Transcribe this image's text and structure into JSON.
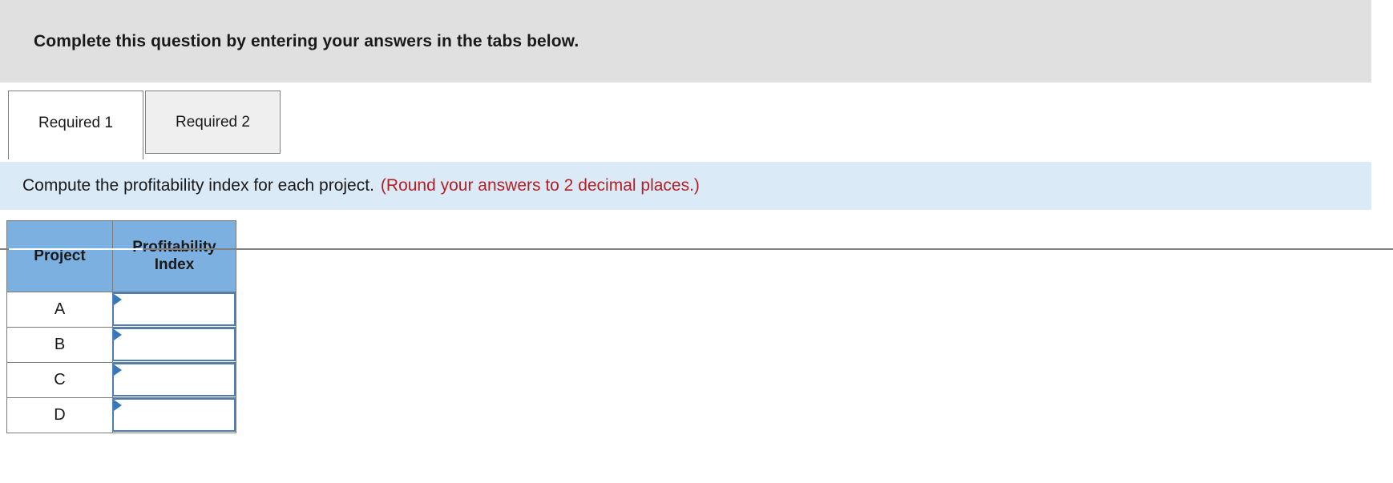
{
  "banner": {
    "text": "Complete this question by entering your answers in the tabs below."
  },
  "tabs": [
    {
      "label": "Required 1",
      "active": true,
      "name": "tab-required-1"
    },
    {
      "label": "Required 2",
      "active": false,
      "name": "tab-required-2"
    }
  ],
  "instruction": {
    "main": "Compute the profitability index for each project.",
    "note": "(Round your answers to 2 decimal places.)"
  },
  "table": {
    "headers": [
      "Project",
      "Profitability Index"
    ],
    "header_project": "Project",
    "header_index_line1": "Profitability",
    "header_index_line2": "Index",
    "rows": [
      {
        "project": "A",
        "value": "",
        "placeholder": ""
      },
      {
        "project": "B",
        "value": "",
        "placeholder": ""
      },
      {
        "project": "C",
        "value": "",
        "placeholder": ""
      },
      {
        "project": "D",
        "value": "",
        "placeholder": ""
      }
    ]
  },
  "colors": {
    "banner_bg": "#e0e0e0",
    "instruction_bg": "#daeaf7",
    "note_text": "#b41f24",
    "table_header_bg": "#7cb0e0",
    "input_border": "#4a7eb5",
    "marker": "#3a77b8",
    "cell_border": "#7a7a7a",
    "tab_inactive_bg": "#efefef"
  }
}
